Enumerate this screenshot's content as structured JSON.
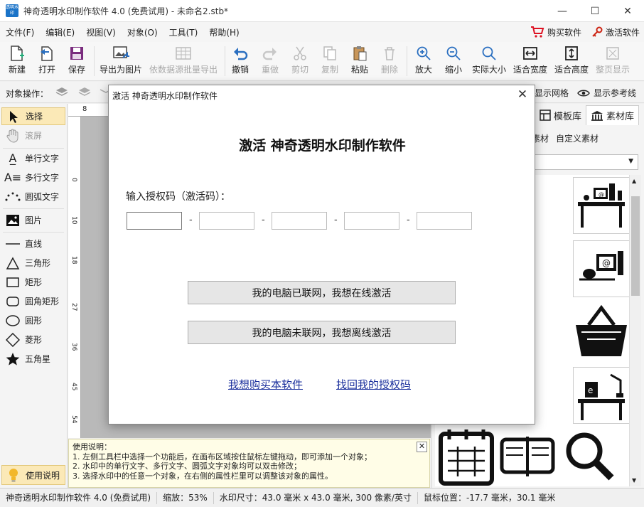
{
  "window": {
    "icon_text": "透明水印",
    "title": "神奇透明水印制作软件 4.0 (免费试用) - 未命名2.stb*",
    "minimize": "—",
    "maximize": "☐",
    "close": "✕"
  },
  "menu": {
    "items": [
      "文件(F)",
      "编辑(E)",
      "视图(V)",
      "对象(O)",
      "工具(T)",
      "帮助(H)"
    ],
    "buy": "购买软件",
    "activate": "激活软件"
  },
  "toolbar": {
    "new": "新建",
    "open": "打开",
    "save": "保存",
    "export_image": "导出为图片",
    "batch_export": "依数据源批量导出",
    "undo": "撤销",
    "redo": "重做",
    "cut": "剪切",
    "copy": "复制",
    "paste": "粘贴",
    "delete": "删除",
    "zoom_in": "放大",
    "zoom_out": "缩小",
    "actual_size": "实际大小",
    "fit_width": "适合宽度",
    "fit_height": "适合高度",
    "full_page": "整页显示"
  },
  "ops": {
    "label": "对象操作：",
    "show_grid": "显示网格",
    "show_guides": "显示参考线"
  },
  "tools": {
    "select": "选择",
    "scroll": "滚屏",
    "single_text": "单行文字",
    "multi_text": "多行文字",
    "arc_text": "圆弧文字",
    "image": "图片",
    "line": "直线",
    "triangle": "三角形",
    "rect": "矩形",
    "round_rect": "圆角矩形",
    "circle": "圆形",
    "diamond": "菱形",
    "star": "五角星",
    "help": "使用说明"
  },
  "ruler": {
    "top_mark": "8",
    "left_marks": [
      "0",
      "10",
      "18",
      "27",
      "36",
      "45",
      "54"
    ]
  },
  "help_box": {
    "title": "使用说明：",
    "lines": [
      "1. 左侧工具栏中选择一个功能后，在画布区域按住鼠标左键拖动，即可添加一个对象；",
      "2. 水印中的单行文字、多行文字、圆弧文字对象均可以双击修改；",
      "3. 选择水印中的任意一个对象，在右侧的属性栏里可以调整该对象的属性。"
    ],
    "close": "✕"
  },
  "right_panel": {
    "tab_templates": "模板库",
    "tab_materials": "素材库",
    "sub_material": "素材",
    "sub_custom": "自定义素材"
  },
  "status": {
    "app": "神奇透明水印制作软件 4.0 (免费试用)",
    "zoom": "缩放：53%",
    "size": "水印尺寸：43.0 毫米 x 43.0 毫米, 300 像素/英寸",
    "mouse": "鼠标位置：-17.7 毫米，30.1 毫米"
  },
  "dialog": {
    "title": "激活 神奇透明水印制作软件",
    "heading": "激活 神奇透明水印制作软件",
    "code_label": "输入授权码（激活码）：",
    "code_values": [
      "",
      "",
      "",
      "",
      ""
    ],
    "dash": "-",
    "online_button": "我的电脑已联网，我想在线激活",
    "offline_button": "我的电脑未联网，我想离线激活",
    "buy_link": "我想购买本软件",
    "recover_link": "找回我的授权码",
    "close": "✕"
  },
  "colors": {
    "accent_selected": "#fbe9b7",
    "link": "#1a2f9c",
    "cart": "#dd1122"
  }
}
